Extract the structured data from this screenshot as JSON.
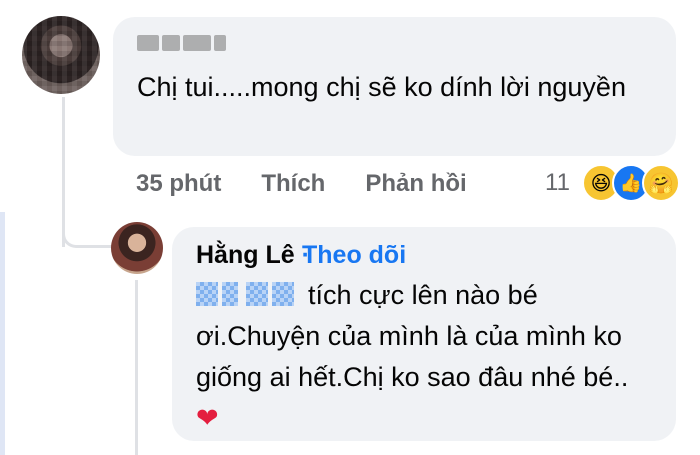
{
  "comment": {
    "text": "Chị tui.....mong chị sẽ ko dính lời nguyền",
    "time": "35 phút",
    "like_label": "Thích",
    "reply_label": "Phản hồi",
    "reaction_count": "11",
    "reactions": [
      "haha-icon",
      "like-icon",
      "care-icon"
    ]
  },
  "reply": {
    "author": "Hằng Lê",
    "separator": "·",
    "follow_label": "Theo dõi",
    "text": "tích cực lên nào bé ơi.Chuyện của mình là của mình ko giống ai hết.Chị ko sao đâu nhé bé..",
    "heart": "❤"
  },
  "colors": {
    "link": "#1877f2",
    "bubble": "#f0f2f5",
    "meta": "#65676b"
  }
}
